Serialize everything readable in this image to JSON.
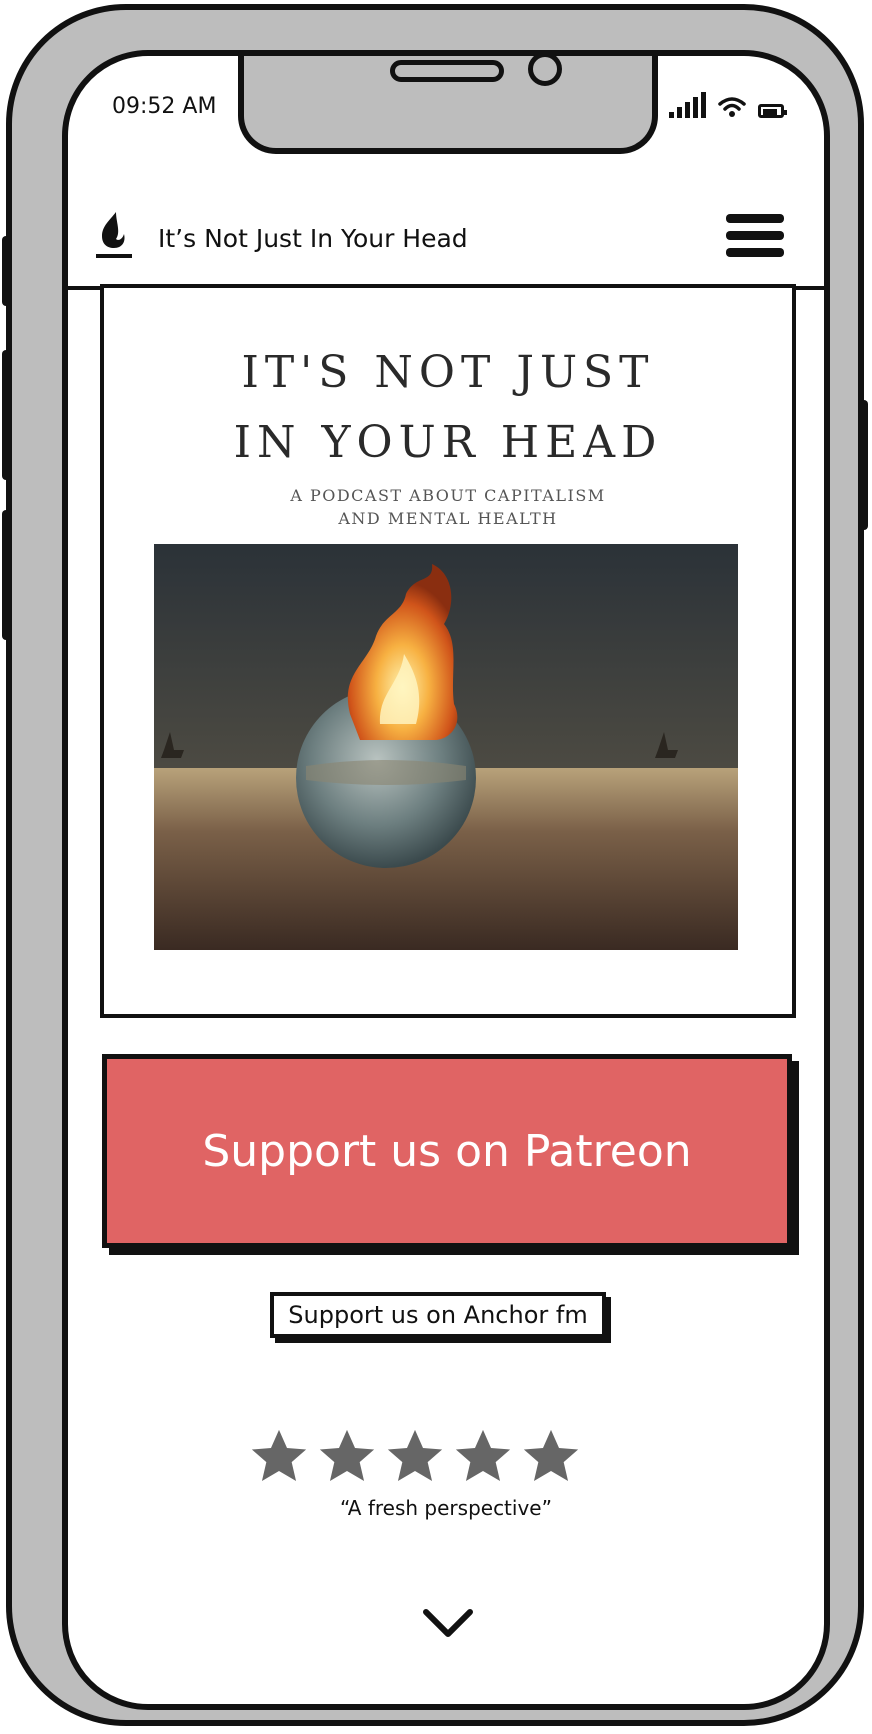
{
  "status_bar": {
    "time": "09:52 AM"
  },
  "header": {
    "title": "It’s Not Just In Your Head"
  },
  "cover": {
    "title_line1": "IT'S NOT JUST",
    "title_line2": "IN YOUR HEAD",
    "subtitle_line1": "A PODCAST ABOUT CAPITALISM",
    "subtitle_line2": "AND MENTAL HEALTH"
  },
  "actions": {
    "patreon_label": "Support us on Patreon",
    "anchor_label": "Support us on Anchor fm"
  },
  "review": {
    "rating": 5,
    "max_rating": 5,
    "quote": "“A fresh perspective”"
  },
  "colors": {
    "accent": "#e06464",
    "phone_frame": "#bdbdbd",
    "star": "#666666"
  },
  "icons": [
    "flame-logo-icon",
    "menu-icon",
    "signal-icon",
    "wifi-icon",
    "battery-icon",
    "star-icon",
    "chevron-down-icon"
  ]
}
